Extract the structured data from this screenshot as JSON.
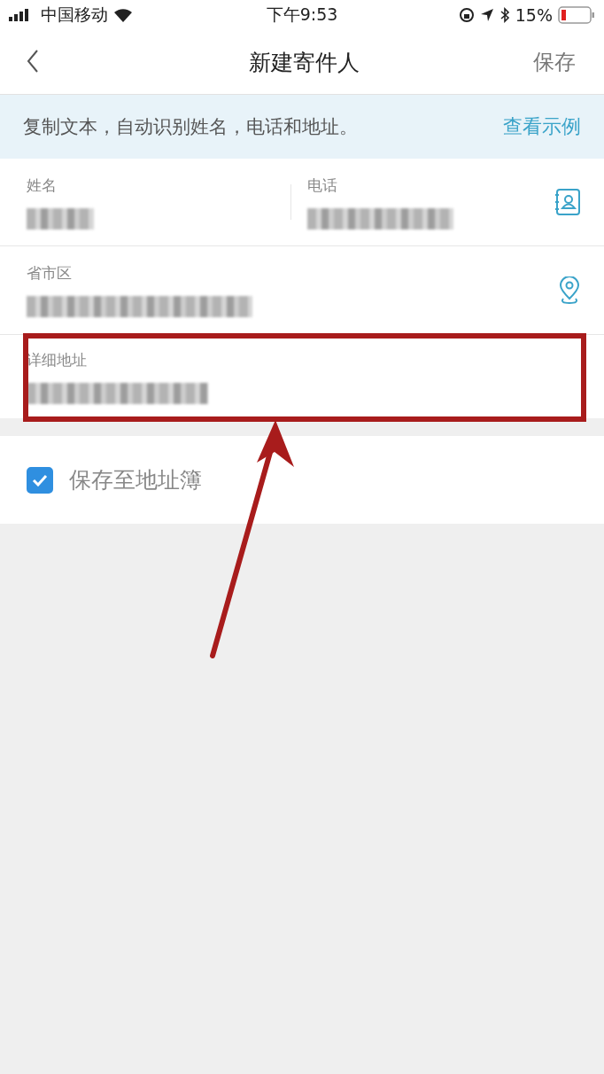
{
  "status_bar": {
    "carrier": "中国移动",
    "time": "下午9:53",
    "battery": "15%"
  },
  "nav": {
    "title": "新建寄件人",
    "action": "保存"
  },
  "banner": {
    "text": "复制文本，自动识别姓名，电话和地址。",
    "link": "查看示例"
  },
  "fields": [
    {
      "kind": "name",
      "label": "姓名"
    },
    {
      "kind": "phone",
      "label": "电话"
    },
    {
      "kind": "region",
      "label": "省市区"
    },
    {
      "kind": "address",
      "label": "详细地址"
    }
  ],
  "save_to_address_book": {
    "label": "保存至地址簿",
    "checked": true
  }
}
